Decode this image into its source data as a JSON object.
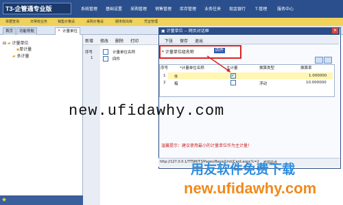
{
  "app": {
    "logo_text": "T3-企管通专业版"
  },
  "menu": [
    "系统管理",
    "基础设置",
    "采购管理",
    "销售管理",
    "库存管理",
    "业务往来",
    "现金银行",
    "T-管理",
    "服务中心"
  ],
  "toolbar": [
    "单据查询",
    "日常收业务",
    "销售价格设",
    "采购价格设",
    "期末收出库",
    "凭证管理"
  ],
  "tabs": [
    "首页",
    "功能导航",
    "计量单位"
  ],
  "tree": {
    "root": "计量单位",
    "children": [
      "单计量",
      "多计量"
    ]
  },
  "middle": {
    "buttons": [
      "新增",
      "修改",
      "删除",
      "打印"
    ],
    "col_index": "序号",
    "col_name": "计量单位名称",
    "rows": [
      {
        "index": "1",
        "name": "四件"
      }
    ]
  },
  "dialog": {
    "title": "计量单位 -- 网页对话框",
    "buttons": [
      "下张",
      "保存",
      "退出"
    ],
    "group_label": "* 计量单位组名称",
    "group_value": "四件",
    "headers": [
      "序号",
      "*计量单位名称",
      "主计量",
      "换算类型",
      "换算率"
    ],
    "rows": [
      {
        "index": "1",
        "name": "件",
        "main": true,
        "type": "",
        "rate": "1.000000"
      },
      {
        "index": "2",
        "name": "箱",
        "main": false,
        "type": "浮动",
        "rate": "10.000000"
      }
    ],
    "warning": "温馨提示：建议使用最小的计量单位作为主计量！",
    "status_url": "http://127.0.0.1/TTSM/T3/Pages/Basis/Unit/Card.aspx?c=2",
    "status_zone": "可信站点"
  },
  "watermarks": {
    "center": "new.ufidawhy.com",
    "zh": "用友软件免费下载",
    "url": "new.ufidawhy.com"
  },
  "colors": {
    "header_blue": "#2a4f8c",
    "toolbar_yellow": "#f0d25a",
    "highlight_red": "#d92121",
    "watermark_blue": "#2b8de0",
    "watermark_orange": "#f08a1c"
  }
}
